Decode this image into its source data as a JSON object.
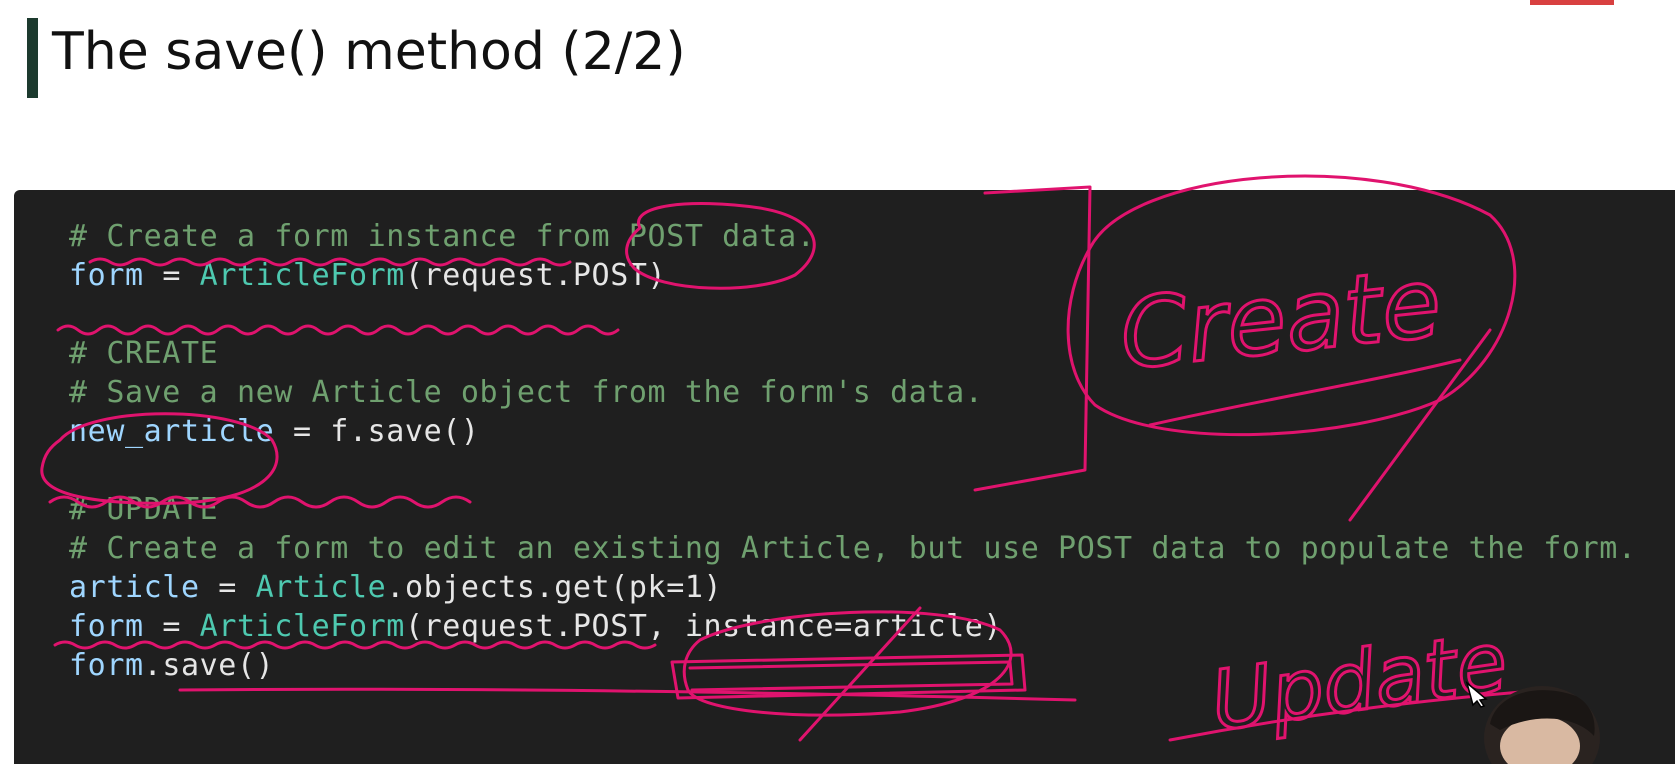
{
  "slide": {
    "title": "The save() method (2/2)"
  },
  "code": {
    "lines": [
      {
        "comment": "# Create a form instance from POST data."
      },
      {
        "var": "form",
        "op": " = ",
        "cls": "ArticleForm",
        "rest": "(request.POST)"
      },
      {
        "comment": "# CREATE"
      },
      {
        "comment": "# Save a new Article object from the form's data."
      },
      {
        "var": "new_article",
        "op": " = ",
        "rest": "f.save()"
      },
      {
        "comment": "# UPDATE"
      },
      {
        "comment": "# Create a form to edit an existing Article, but use POST data to populate the form."
      },
      {
        "var": "article",
        "op": " = ",
        "cls": "Article",
        "rest": ".objects.get(pk=1)"
      },
      {
        "var": "form",
        "op": " = ",
        "cls": "ArticleForm",
        "rest": "(request.POST, instance=article)"
      },
      {
        "var": "form",
        "rest": ".save()"
      }
    ]
  },
  "annotations": {
    "create_label": "Create",
    "update_label": "Update",
    "ink_color": "#e0136e"
  },
  "colors": {
    "background": "#ffffff",
    "code_bg": "#1f1f1f",
    "title_accent": "#1c3a2e",
    "comment": "#6fa06f"
  }
}
